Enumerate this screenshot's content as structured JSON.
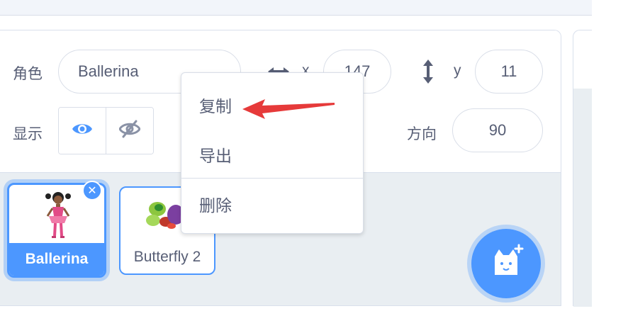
{
  "sprite_info": {
    "sprite_label": "角色",
    "sprite_name": "Ballerina",
    "x_label": "x",
    "x_value": "147",
    "y_label": "y",
    "y_value": "11",
    "show_label": "显示",
    "direction_label": "方向",
    "direction_value": "90"
  },
  "context_menu": {
    "items": [
      {
        "label": "复制"
      },
      {
        "label": "导出"
      },
      {
        "label": "删除"
      }
    ]
  },
  "sprites": [
    {
      "name": "Ballerina",
      "selected": true
    },
    {
      "name": "Butterfly 2",
      "selected": false
    }
  ],
  "colors": {
    "accent": "#4c97ff",
    "text": "#575e75",
    "panel_bg": "#e9eef2",
    "arrow": "#e63a3a"
  },
  "icons": {
    "show": "eye-icon",
    "hide": "eye-slash-icon",
    "x_arrow": "horizontal-arrows-icon",
    "y_arrow": "vertical-arrows-icon",
    "add_sprite": "cat-plus-icon",
    "delete": "close-icon"
  }
}
